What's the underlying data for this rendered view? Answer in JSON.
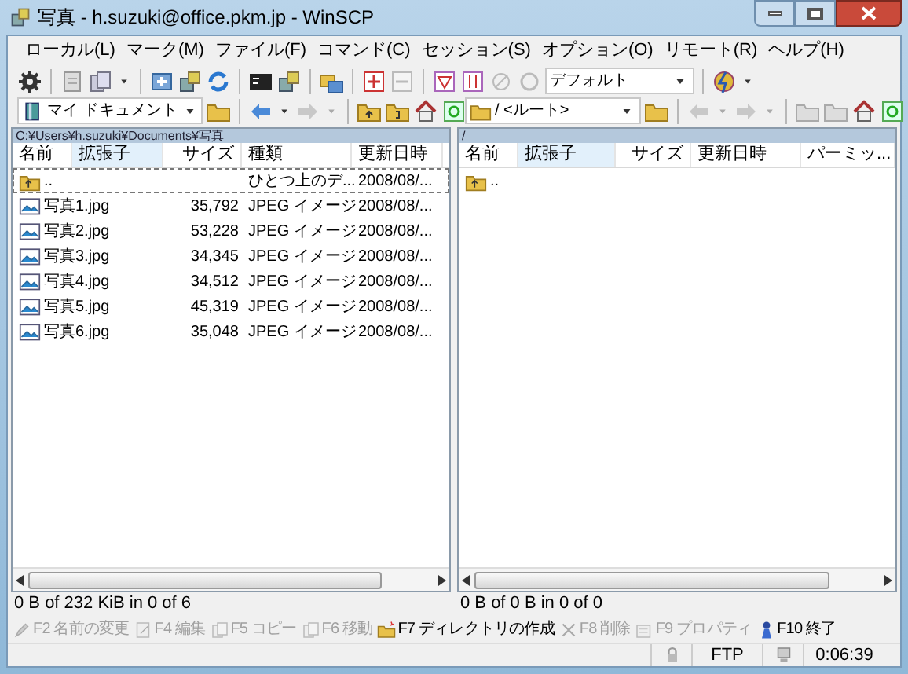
{
  "window": {
    "title": "写真 - h.suzuki@office.pkm.jp - WinSCP"
  },
  "menu": [
    "ローカル(L)",
    "マーク(M)",
    "ファイル(F)",
    "コマンド(C)",
    "セッション(S)",
    "オプション(O)",
    "リモート(R)",
    "ヘルプ(H)"
  ],
  "toolbar": {
    "profile_dropdown": "デフォルト"
  },
  "left_panel": {
    "location_dropdown": "マイ ドキュメント",
    "path": "C:¥Users¥h.suzuki¥Documents¥写真",
    "columns": [
      {
        "label": "名前",
        "sorted": false
      },
      {
        "label": "拡張子",
        "sorted": true
      },
      {
        "label": "サイズ",
        "sorted": false
      },
      {
        "label": "種類",
        "sorted": false
      },
      {
        "label": "更新日時",
        "sorted": false
      }
    ],
    "rows": [
      {
        "kind": "parent",
        "name": "..",
        "size": "",
        "type": "ひとつ上のデ...",
        "modified": "2008/08/...",
        "focused": true
      },
      {
        "kind": "image",
        "name": "写真1.jpg",
        "size": "35,792",
        "type": "JPEG イメージ",
        "modified": "2008/08/...",
        "focused": false
      },
      {
        "kind": "image",
        "name": "写真2.jpg",
        "size": "53,228",
        "type": "JPEG イメージ",
        "modified": "2008/08/...",
        "focused": false
      },
      {
        "kind": "image",
        "name": "写真3.jpg",
        "size": "34,345",
        "type": "JPEG イメージ",
        "modified": "2008/08/...",
        "focused": false
      },
      {
        "kind": "image",
        "name": "写真4.jpg",
        "size": "34,512",
        "type": "JPEG イメージ",
        "modified": "2008/08/...",
        "focused": false
      },
      {
        "kind": "image",
        "name": "写真5.jpg",
        "size": "45,319",
        "type": "JPEG イメージ",
        "modified": "2008/08/...",
        "focused": false
      },
      {
        "kind": "image",
        "name": "写真6.jpg",
        "size": "35,048",
        "type": "JPEG イメージ",
        "modified": "2008/08/...",
        "focused": false
      }
    ],
    "status": "0 B of 232 KiB in 0 of 6"
  },
  "right_panel": {
    "location_dropdown": "/ <ルート>",
    "path": "/",
    "columns": [
      {
        "label": "名前",
        "sorted": false
      },
      {
        "label": "拡張子",
        "sorted": true
      },
      {
        "label": "サイズ",
        "sorted": false
      },
      {
        "label": "更新日時",
        "sorted": false
      },
      {
        "label": "パーミッ...",
        "sorted": false
      }
    ],
    "rows": [
      {
        "kind": "parent",
        "name": ".."
      }
    ],
    "status": "0 B of 0 B in 0 of 0"
  },
  "function_keys": [
    {
      "key": "F2",
      "label": "名前の変更",
      "disabled": true
    },
    {
      "key": "F4",
      "label": "編集",
      "disabled": true
    },
    {
      "key": "F5",
      "label": "コピー",
      "disabled": true
    },
    {
      "key": "F6",
      "label": "移動",
      "disabled": true
    },
    {
      "key": "F7",
      "label": "ディレクトリの作成",
      "disabled": false
    },
    {
      "key": "F8",
      "label": "削除",
      "disabled": true
    },
    {
      "key": "F9",
      "label": "プロパティ",
      "disabled": true
    },
    {
      "key": "F10",
      "label": "終了",
      "disabled": false
    }
  ],
  "status_bar": {
    "protocol": "FTP",
    "elapsed": "0:06:39"
  }
}
